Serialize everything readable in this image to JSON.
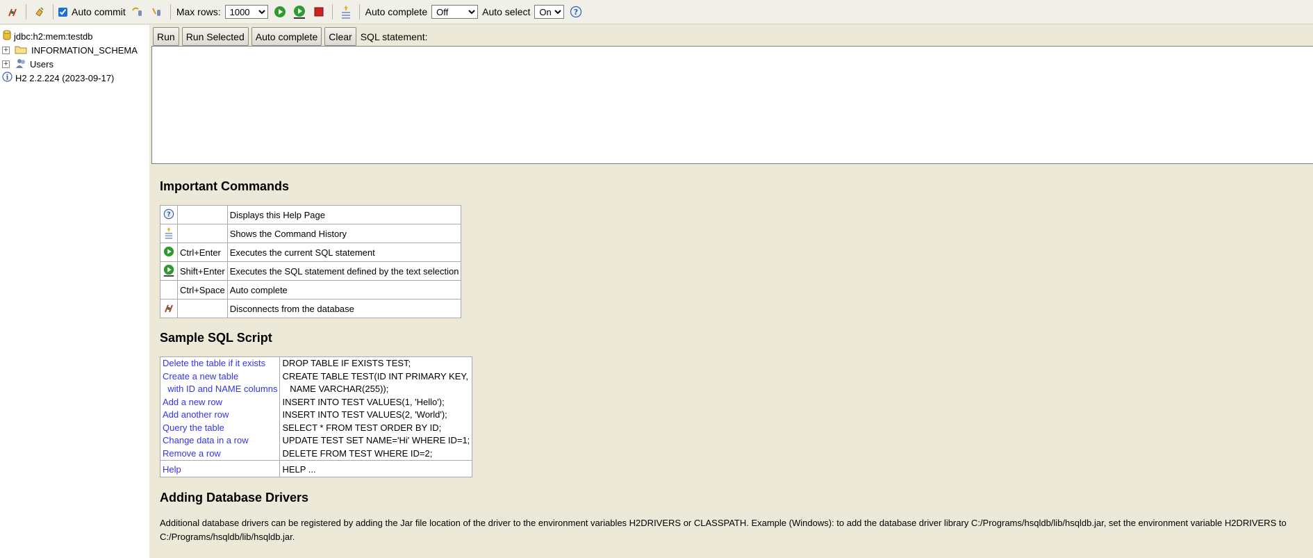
{
  "toolbar": {
    "auto_commit_label": "Auto commit",
    "auto_commit_checked": true,
    "max_rows_label": "Max rows:",
    "max_rows_value": "1000",
    "auto_complete_label": "Auto complete",
    "auto_complete_value": "Off",
    "auto_select_label": "Auto select",
    "auto_select_value": "On",
    "icons": [
      "disconnect-icon",
      "refresh-icon",
      "rollback-icon",
      "commit-icon",
      "run-icon",
      "run-selected-icon",
      "stop-icon",
      "history-icon",
      "help-icon"
    ]
  },
  "tree": {
    "connection": "jdbc:h2:mem:testdb",
    "schema": "INFORMATION_SCHEMA",
    "users": "Users",
    "version": "H2 2.2.224 (2023-09-17)"
  },
  "editor": {
    "run": "Run",
    "run_selected": "Run Selected",
    "auto_complete": "Auto complete",
    "clear": "Clear",
    "sql_label": "SQL statement:"
  },
  "important": {
    "title": "Important Commands",
    "rows": [
      {
        "icon": "help-icon",
        "key": "",
        "desc": "Displays this Help Page"
      },
      {
        "icon": "history-icon",
        "key": "",
        "desc": "Shows the Command History"
      },
      {
        "icon": "run-icon",
        "key": "Ctrl+Enter",
        "desc": "Executes the current SQL statement"
      },
      {
        "icon": "run-selected-icon",
        "key": "Shift+Enter",
        "desc": "Executes the SQL statement defined by the text selection"
      },
      {
        "icon": "",
        "key": "Ctrl+Space",
        "desc": "Auto complete"
      },
      {
        "icon": "disconnect-icon",
        "key": "",
        "desc": "Disconnects from the database"
      }
    ]
  },
  "sample": {
    "title": "Sample SQL Script",
    "rows": [
      {
        "label": "Delete the table if it exists",
        "sql": "DROP TABLE IF EXISTS TEST;"
      },
      {
        "label": "Create a new table",
        "sql": "CREATE TABLE TEST(ID INT PRIMARY KEY,"
      },
      {
        "label": "  with ID and NAME columns",
        "sql": "   NAME VARCHAR(255));"
      },
      {
        "label": "Add a new row",
        "sql": "INSERT INTO TEST VALUES(1, 'Hello');"
      },
      {
        "label": "Add another row",
        "sql": "INSERT INTO TEST VALUES(2, 'World');"
      },
      {
        "label": "Query the table",
        "sql": "SELECT * FROM TEST ORDER BY ID;"
      },
      {
        "label": "Change data in a row",
        "sql": "UPDATE TEST SET NAME='Hi' WHERE ID=1;"
      },
      {
        "label": "Remove a row",
        "sql": "DELETE FROM TEST WHERE ID=2;"
      }
    ],
    "help_label": "Help",
    "help_sql": "HELP ..."
  },
  "drivers": {
    "title": "Adding Database Drivers",
    "text": "Additional database drivers can be registered by adding the Jar file location of the driver to the environment variables H2DRIVERS or CLASSPATH. Example (Windows): to add the database driver library C:/Programs/hsqldb/lib/hsqldb.jar, set the environment variable H2DRIVERS to C:/Programs/hsqldb/lib/hsqldb.jar."
  }
}
